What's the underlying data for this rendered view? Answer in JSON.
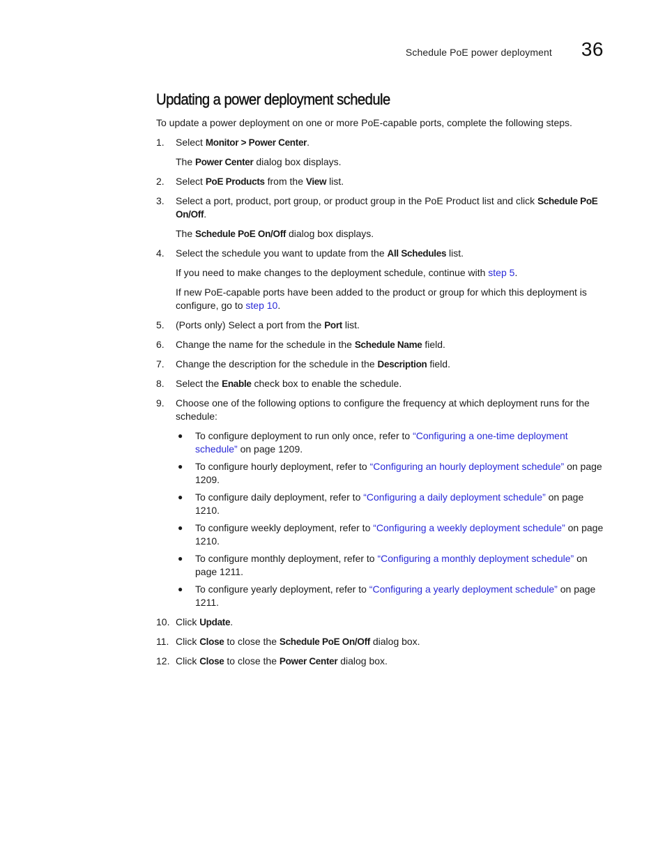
{
  "header": {
    "running_title": "Schedule PoE power deployment",
    "chapter_number": "36"
  },
  "section": {
    "title": "Updating a power deployment schedule",
    "intro": "To update a power deployment on one or more PoE-capable ports, complete the following steps."
  },
  "steps": [
    {
      "num": "1.",
      "parts": [
        "Select ",
        "Monitor > Power Center",
        "."
      ],
      "note_parts": [
        "The ",
        "Power Center",
        " dialog box displays."
      ]
    },
    {
      "num": "2.",
      "parts": [
        "Select ",
        "PoE Products",
        " from the ",
        "View",
        " list."
      ]
    },
    {
      "num": "3.",
      "parts": [
        "Select a port, product, port group, or product group in the PoE Product list and click ",
        "Schedule PoE On/Off",
        "."
      ],
      "note_parts": [
        "The ",
        "Schedule PoE On/Off",
        " dialog box displays."
      ]
    },
    {
      "num": "4.",
      "parts": [
        "Select the schedule you want to update from the ",
        "All Schedules",
        " list."
      ],
      "note1": {
        "before": "If you need to make changes to the deployment schedule, continue with ",
        "link": "step 5",
        "after": "."
      },
      "note2": {
        "before": "If new PoE-capable ports have been added to the product or group for which this deployment is configure, go to ",
        "link": "step 10",
        "after": "."
      }
    },
    {
      "num": "5.",
      "parts": [
        "(Ports only) Select a port from the ",
        "Port",
        " list."
      ]
    },
    {
      "num": "6.",
      "parts": [
        "Change the name for the schedule in the ",
        "Schedule Name",
        " field."
      ]
    },
    {
      "num": "7.",
      "parts": [
        "Change the description for the schedule in the ",
        "Description",
        " field."
      ]
    },
    {
      "num": "8.",
      "parts": [
        "Select the ",
        "Enable",
        " check box to enable the schedule."
      ]
    },
    {
      "num": "9.",
      "text": "Choose one of the following options to configure the frequency at which deployment runs for the schedule:",
      "options": [
        {
          "before": "To configure deployment to run only once, refer to ",
          "link": "“Configuring a one-time deployment schedule”",
          "after": " on page 1209."
        },
        {
          "before": "To configure hourly deployment, refer to ",
          "link": "“Configuring an hourly deployment schedule”",
          "after": " on page 1209."
        },
        {
          "before": "To configure daily deployment, refer to ",
          "link": "“Configuring a daily deployment schedule”",
          "after": " on page 1210."
        },
        {
          "before": "To configure weekly deployment, refer to ",
          "link": "“Configuring a weekly deployment schedule”",
          "after": " on page 1210."
        },
        {
          "before": "To configure monthly deployment, refer to ",
          "link": "“Configuring a monthly deployment schedule”",
          "after": " on page 1211."
        },
        {
          "before": "To configure yearly deployment, refer to ",
          "link": "“Configuring a yearly deployment schedule”",
          "after": " on page 1211."
        }
      ]
    },
    {
      "num": "10.",
      "parts": [
        "Click ",
        "Update",
        "."
      ]
    },
    {
      "num": "11.",
      "parts": [
        "Click ",
        "Close",
        " to close the ",
        "Schedule PoE On/Off",
        " dialog box."
      ]
    },
    {
      "num": "12.",
      "parts": [
        "Click ",
        "Close",
        " to close the ",
        "Power Center",
        " dialog box."
      ]
    }
  ],
  "colors": {
    "link": "#2a2ad8",
    "text": "#1a1a1a"
  }
}
